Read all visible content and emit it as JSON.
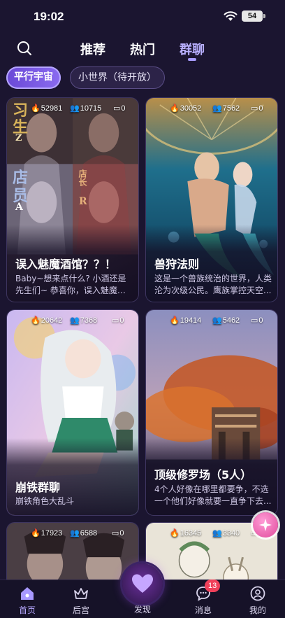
{
  "status_bar": {
    "time": "19:02",
    "battery": "54"
  },
  "top_nav": {
    "tabs": [
      {
        "label": "推荐",
        "active": false
      },
      {
        "label": "热门",
        "active": false
      },
      {
        "label": "群聊",
        "active": true
      }
    ]
  },
  "filters": [
    {
      "label": "平行宇宙",
      "active": true
    },
    {
      "label": "小世界（待开放）",
      "active": false
    }
  ],
  "cards": [
    {
      "hot": "52981",
      "members": "10715",
      "messages": "0",
      "title": "误入魅魔酒馆？？！",
      "description": "Baby~想来点什么? 小酒还是先生们~ 恭喜你，误入魅魔酒馆...",
      "poster_text": [
        "习",
        "生",
        "Z",
        "店",
        "员",
        "A",
        "店长",
        "R"
      ]
    },
    {
      "hot": "30052",
      "members": "7562",
      "messages": "0",
      "title": "兽狩法则",
      "description": "这是一个兽族统治的世界，人类沦为次级公民。鹰族掌控天空..."
    },
    {
      "hot": "20642",
      "members": "7368",
      "messages": "0",
      "title": "崩铁群聊",
      "description": "崩铁角色大乱斗"
    },
    {
      "hot": "19414",
      "members": "5462",
      "messages": "0",
      "title": "顶级修罗场（5人）",
      "description": "4个人好像在哪里都要争，不选一个他们好像就要一直争下去..."
    },
    {
      "hot": "17923",
      "members": "6588",
      "messages": "0"
    },
    {
      "hot": "16345",
      "members": "3340",
      "messages": "0"
    }
  ],
  "bottom_nav": {
    "items": [
      {
        "label": "首页",
        "icon": "home-icon",
        "active": true
      },
      {
        "label": "后宫",
        "icon": "crown-icon",
        "active": false
      },
      {
        "label": "发现",
        "icon": "heart-icon",
        "active": false
      },
      {
        "label": "消息",
        "icon": "chat-bubble-icon",
        "active": false,
        "badge": "13"
      },
      {
        "label": "我的",
        "icon": "profile-icon",
        "active": false
      }
    ]
  },
  "colors": {
    "background": "#1b1530",
    "accent": "#a79bff",
    "badge": "#f0405a",
    "fab": "#e04a9b"
  }
}
